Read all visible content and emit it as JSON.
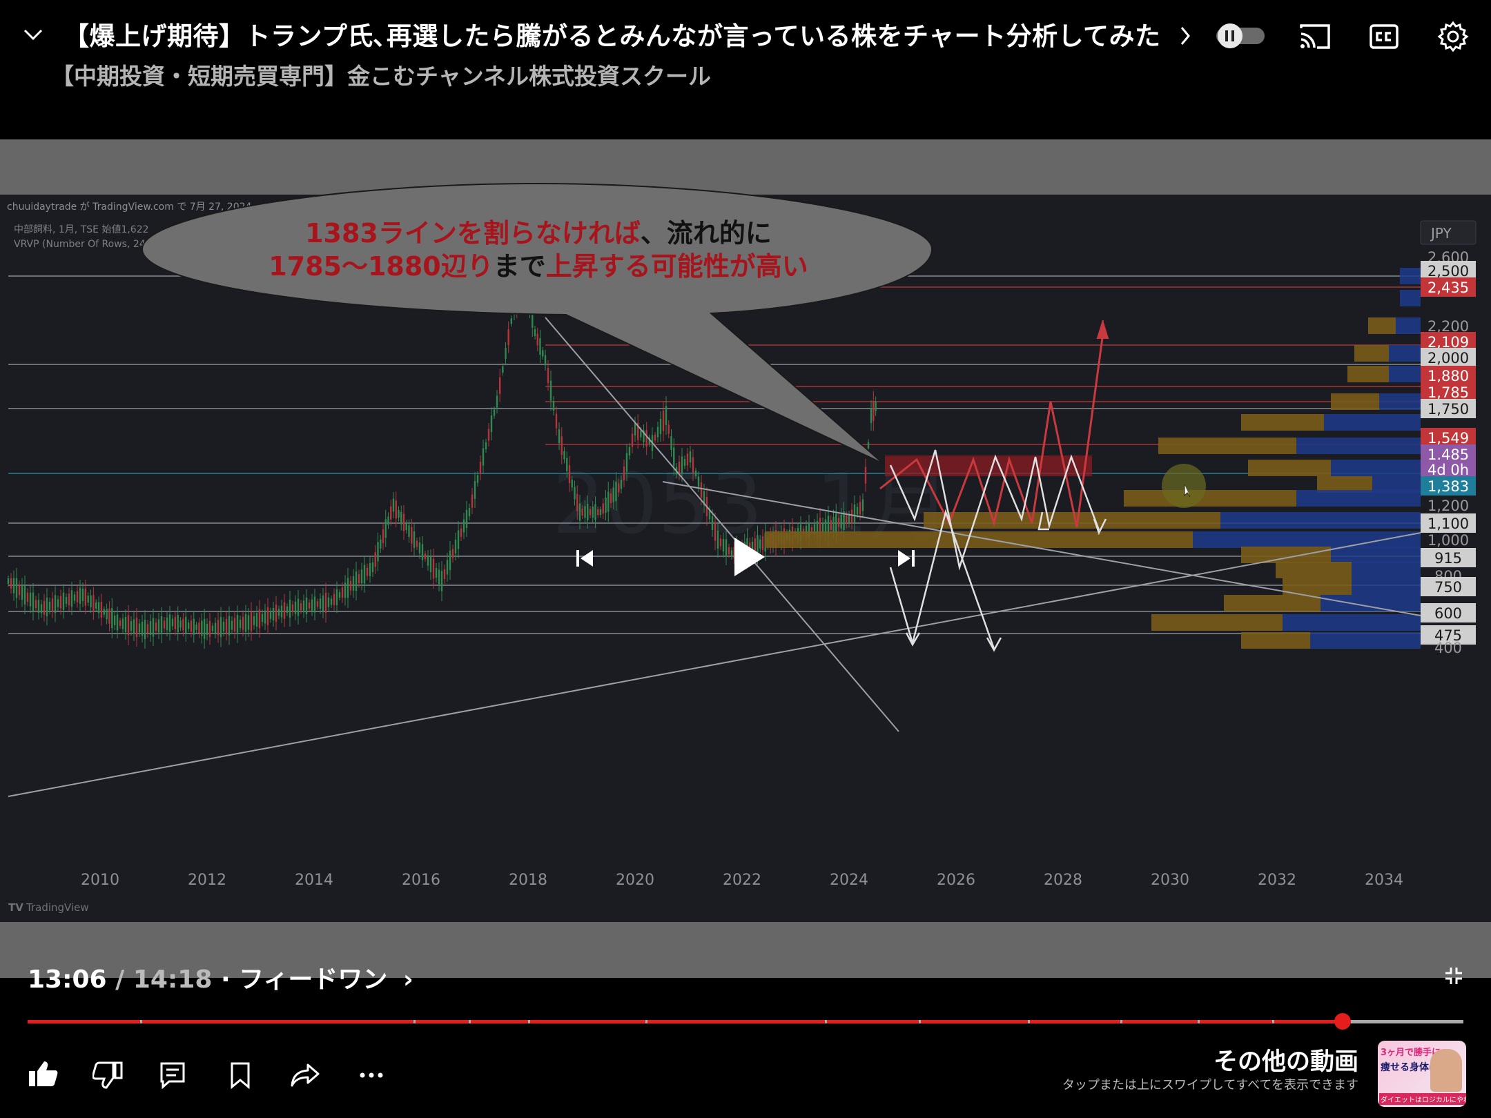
{
  "header": {
    "video_title": "【爆上げ期待】トランプ氏､再選したら騰がるとみんなが言っている株をチャート分析してみた",
    "channel_name": "【中期投資・短期売買専門】金こむチャンネル株式投資スクール"
  },
  "video": {
    "watermark_text": "chuuidaytrade が TradingView.com で 7月 27, 2024",
    "symbol_info": "中部飼料, 1月, TSE  始値1,622",
    "indicator_info": "VRVP (Number Of Rows, 24, U",
    "currency": "JPY",
    "tradingview_label": "TradingView",
    "callout_line1": {
      "red1": "1383ラインを割らなければ",
      "black1": "、流れ的に"
    },
    "callout_line2": {
      "red2": "1785～1880辺り",
      "black2": "まで",
      "red3": "上昇する可能性が高い"
    },
    "price_labels": [
      {
        "text": "2,600",
        "boxed": false,
        "color": "#9a9a9a"
      },
      {
        "text": "2,500",
        "boxed": true,
        "color": "#cfcfcf"
      },
      {
        "text": "2,435",
        "boxed": true,
        "color": "#c2363a"
      },
      {
        "text": "2,200",
        "boxed": false,
        "color": "#9a9a9a"
      },
      {
        "text": "2,109",
        "boxed": true,
        "color": "#c2363a"
      },
      {
        "text": "2,000",
        "boxed": true,
        "color": "#cfcfcf"
      },
      {
        "text": "1,880",
        "boxed": true,
        "color": "#c2363a"
      },
      {
        "text": "1,785",
        "boxed": true,
        "color": "#c2363a"
      },
      {
        "text": "1,750",
        "boxed": true,
        "color": "#cfcfcf"
      },
      {
        "text": "1,549",
        "boxed": true,
        "color": "#c2363a"
      },
      {
        "text": "1,485",
        "boxed": true,
        "color": "#8e5aa8"
      },
      {
        "text": "4d 0h",
        "boxed": true,
        "color": "#8e5aa8"
      },
      {
        "text": "1,383",
        "boxed": true,
        "color": "#1f7f9a"
      },
      {
        "text": "1,200",
        "boxed": false,
        "color": "#9a9a9a"
      },
      {
        "text": "1,100",
        "boxed": true,
        "color": "#cfcfcf"
      },
      {
        "text": "1,000",
        "boxed": false,
        "color": "#9a9a9a"
      },
      {
        "text": "915",
        "boxed": true,
        "color": "#cfcfcf"
      },
      {
        "text": "800",
        "boxed": false,
        "color": "#9a9a9a"
      },
      {
        "text": "750",
        "boxed": true,
        "color": "#cfcfcf"
      },
      {
        "text": "600",
        "boxed": true,
        "color": "#cfcfcf"
      },
      {
        "text": "475",
        "boxed": true,
        "color": "#cfcfcf"
      },
      {
        "text": "400",
        "boxed": false,
        "color": "#9a9a9a"
      }
    ],
    "year_labels": [
      "2010",
      "2012",
      "2014",
      "2016",
      "2018",
      "2020",
      "2022",
      "2024",
      "2026",
      "2028",
      "2030",
      "2032",
      "2034"
    ]
  },
  "player": {
    "current_time": "13:06",
    "separator": " / ",
    "duration": "14:18",
    "chapter": " · フィードワン",
    "chapter_chevron": "›",
    "progress_fraction": 0.916
  },
  "actions": {
    "more_videos_title": "その他の動画",
    "more_videos_sub": "タップまたは上にスワイプしてすべてを表示できます",
    "thumb_text1": "3ヶ月で勝手に",
    "thumb_text2": "痩せる身体に",
    "thumb_text3": "ダイエットはロジカルにやれ"
  },
  "colors": {
    "accent_red": "#e51d1d",
    "callout_red": "#a8141b"
  }
}
